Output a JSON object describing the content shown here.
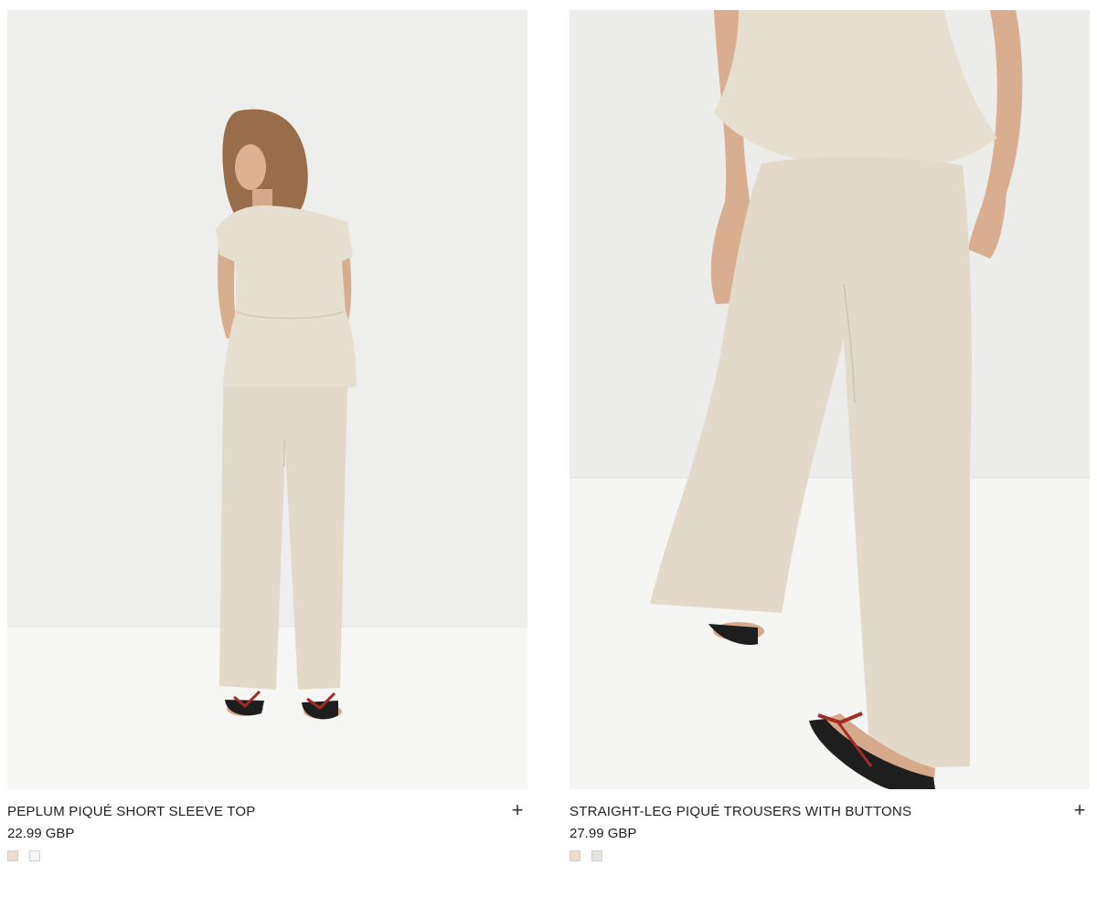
{
  "products": [
    {
      "name": "PEPLUM PIQUÉ SHORT SLEEVE TOP",
      "price": "22.99 GBP",
      "add_icon": "plus-icon",
      "swatches": [
        "#ecdcc9",
        "#f4f6f8"
      ]
    },
    {
      "name": "STRAIGHT-LEG PIQUÉ TROUSERS WITH BUTTONS",
      "price": "27.99 GBP",
      "add_icon": "plus-icon",
      "swatches": [
        "#ecdcc9",
        "#e3e6dc"
      ]
    }
  ],
  "colors": {
    "background": "#ffffff",
    "backdrop": "#efefee",
    "floor": "#f4f4f3",
    "garment": "#e4dccd",
    "skin": "#d9ad8f",
    "sandal": "#1e1e1e",
    "strap": "#a32a25"
  }
}
